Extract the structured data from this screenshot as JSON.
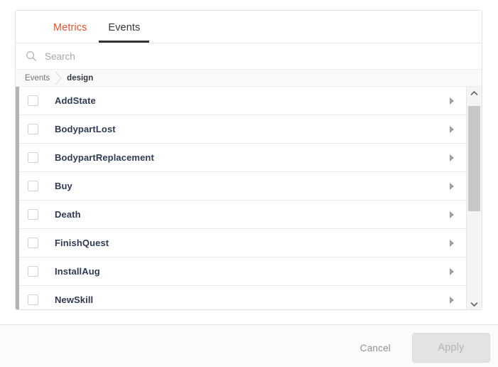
{
  "dialog": {
    "tabs": [
      {
        "label": "Metrics",
        "state": "inactive",
        "color": "#e8542b"
      },
      {
        "label": "Events",
        "state": "active",
        "color": "#32363b"
      }
    ],
    "search": {
      "placeholder": "Search",
      "value": "",
      "icon": "search-icon"
    },
    "breadcrumb": {
      "items": [
        {
          "label": "Events",
          "current": false
        },
        {
          "label": "design",
          "current": true
        }
      ],
      "separator_icon": "chevron-right-icon"
    },
    "list": {
      "rows": [
        {
          "label": "AddState",
          "checked": false,
          "has_children": true
        },
        {
          "label": "BodypartLost",
          "checked": false,
          "has_children": true
        },
        {
          "label": "BodypartReplacement",
          "checked": false,
          "has_children": true
        },
        {
          "label": "Buy",
          "checked": false,
          "has_children": true
        },
        {
          "label": "Death",
          "checked": false,
          "has_children": true
        },
        {
          "label": "FinishQuest",
          "checked": false,
          "has_children": true
        },
        {
          "label": "InstallAug",
          "checked": false,
          "has_children": true
        },
        {
          "label": "NewSkill",
          "checked": false,
          "has_children": true
        }
      ],
      "scrollbar": {
        "up_icon": "chevron-up-icon",
        "down_icon": "chevron-down-icon",
        "thumb_color": "#c8c8c8"
      },
      "row_arrow_icon": "triangle-right-icon"
    },
    "footer": {
      "cancel_label": "Cancel",
      "apply_label": "Apply",
      "apply_enabled": false
    }
  }
}
